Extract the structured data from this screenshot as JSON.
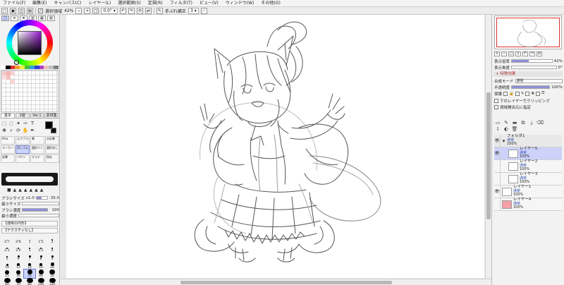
{
  "menu": [
    "ファイル(F)",
    "編集(E)",
    "キャンバス(C)",
    "レイヤー(L)",
    "選択範囲(S)",
    "定規(R)",
    "フィルタ(T)",
    "ビュー(V)",
    "ウィンドウ(W)",
    "その他(O)"
  ],
  "toolbar": {
    "selection_source": "選択領域",
    "zoom": "42%",
    "rotation": "0.0°",
    "stabilizer_label": "手ぶれ補正",
    "stabilizer_value": "3"
  },
  "left": {
    "tool_tabs": [
      "基本",
      "2値",
      "Ver.1",
      "素材集"
    ],
    "brushes": [
      "Pixa",
      "エアブラシ",
      "筆",
      "水彩筆",
      "マーカー",
      "消しゴム",
      "選択ペン",
      "選択消し",
      "鉛筆",
      "バケツ",
      "グラデ",
      "指先"
    ],
    "brush_size": {
      "label": "ブラシサイズ",
      "multiplier": "x1.0",
      "value": "35.0",
      "fill": 0.45
    },
    "min_size": {
      "label": "最小サイズ",
      "fill": 0.0
    },
    "density": {
      "label": "ブラシ濃度",
      "value": "100",
      "fill": 1.0
    },
    "min_density": {
      "label": "最小濃度",
      "fill": 0.0
    },
    "texture_1": "【通常の円形】",
    "texture_2": "【テクスチャなし】",
    "sizes": [
      "0.7",
      "0.8",
      "1",
      "1.5",
      "2",
      "2.3",
      "2.6",
      "3",
      "3.5",
      "4",
      "5",
      "6",
      "7",
      "8",
      "9",
      "10",
      "12",
      "14",
      "16",
      "20",
      "25",
      "30",
      "35",
      "40",
      "50",
      "60",
      "70",
      "80",
      "100",
      "120"
    ],
    "selected_size": "35"
  },
  "right": {
    "zoom_label": "表示倍率",
    "zoom_value": "42%",
    "angle_label": "表示角度",
    "angle_value": "0°",
    "effects_label": "+ 特殊効果",
    "blend_label": "合成モード",
    "blend_value": "通常",
    "opacity_label": "不透明度",
    "opacity_value": "100%",
    "opacity_fill": 1.0,
    "protect_label": "保護",
    "clip_label": "下のレイヤーでクリッピング",
    "select_label": "領域検出元に指定",
    "layers": [
      {
        "name": "フォルダ1",
        "mode": "通常",
        "opacity": "100%",
        "type": "folder"
      },
      {
        "name": "レイヤー5",
        "mode": "通常",
        "opacity": "100%",
        "type": "layer",
        "selected": true
      },
      {
        "name": "レイヤー2",
        "mode": "通常",
        "opacity": "100%",
        "type": "layer"
      },
      {
        "name": "レイヤー3",
        "mode": "通常",
        "opacity": "100%",
        "type": "layer"
      },
      {
        "name": "レイヤー1",
        "mode": "通常",
        "opacity": "100%",
        "type": "layer"
      },
      {
        "name": "レイヤー4",
        "mode": "通常",
        "opacity": "100%",
        "type": "layer",
        "thumb_color": "#f4a0a8"
      }
    ]
  },
  "colors": {
    "primary": "#000000",
    "secondary": "#111111",
    "hue": "#9a1cd6",
    "accent": "#cdd2fb",
    "layer4_thumb": "#f4a0a8",
    "swatches": [
      "#ffffff",
      "#000000",
      "#e03030",
      "#f0a030",
      "#f0f040",
      "#40c040",
      "#30a0e0",
      "#3040d0",
      "#b040c0",
      "#f0c0c0",
      "#c0c0c0",
      "#808080"
    ]
  }
}
